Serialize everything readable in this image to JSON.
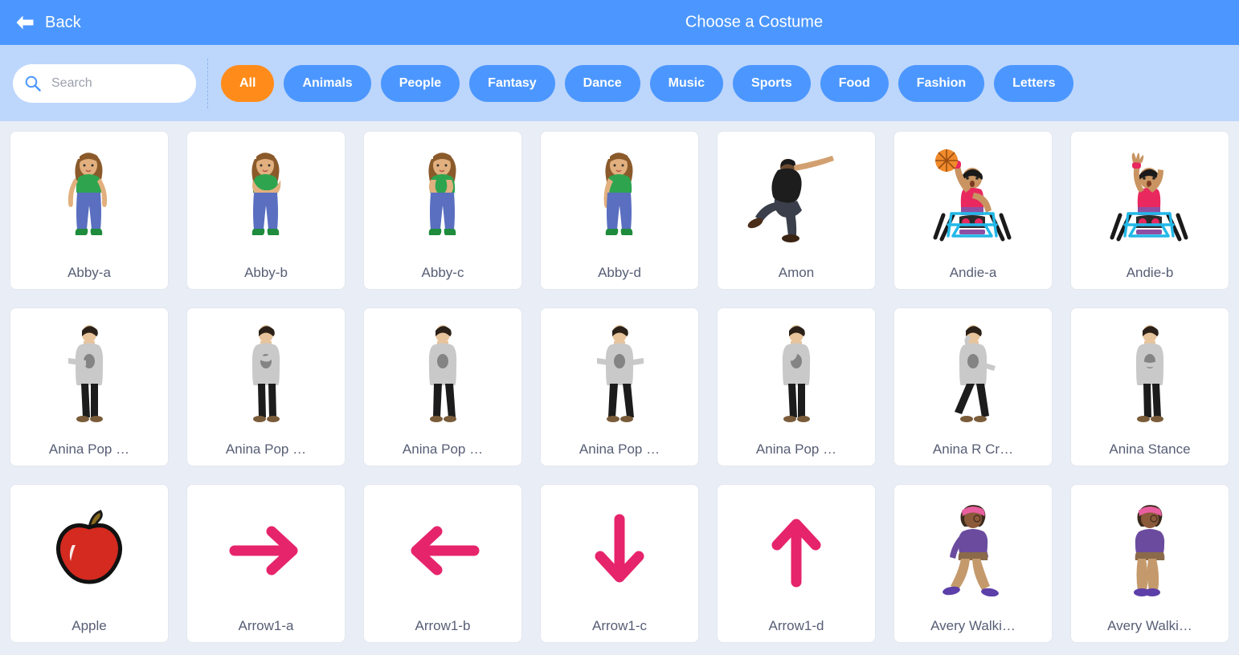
{
  "header": {
    "back_label": "Back",
    "back_icon": "left-arrow-icon",
    "title": "Choose a Costume",
    "bg_color": "#4C97FF"
  },
  "filterbar": {
    "bg_color": "#BDD6FC",
    "search": {
      "icon": "search-icon",
      "placeholder": "Search",
      "value": ""
    },
    "tags": [
      {
        "label": "All",
        "selected": true
      },
      {
        "label": "Animals",
        "selected": false
      },
      {
        "label": "People",
        "selected": false
      },
      {
        "label": "Fantasy",
        "selected": false
      },
      {
        "label": "Dance",
        "selected": false
      },
      {
        "label": "Music",
        "selected": false
      },
      {
        "label": "Sports",
        "selected": false
      },
      {
        "label": "Food",
        "selected": false
      },
      {
        "label": "Fashion",
        "selected": false
      },
      {
        "label": "Letters",
        "selected": false
      }
    ],
    "selected_color": "#FF8C1A",
    "tag_color": "#4C97FF"
  },
  "grid": {
    "bg_color": "#E9EEF6",
    "items": [
      {
        "label": "Abby-a",
        "thumb": "girl-green-shirt-standing"
      },
      {
        "label": "Abby-b",
        "thumb": "girl-green-shirt-arms-crossed"
      },
      {
        "label": "Abby-c",
        "thumb": "girl-green-shirt-hands-up"
      },
      {
        "label": "Abby-d",
        "thumb": "girl-green-shirt-side"
      },
      {
        "label": "Amon",
        "thumb": "man-black-shirt-leaning"
      },
      {
        "label": "Andie-a",
        "thumb": "wheelchair-basketball-throw"
      },
      {
        "label": "Andie-b",
        "thumb": "wheelchair-basketball-arms-up"
      },
      {
        "label": "Anina Pop …",
        "thumb": "woman-grey-sweater-arm-out"
      },
      {
        "label": "Anina Pop …",
        "thumb": "woman-grey-sweater-arm-front"
      },
      {
        "label": "Anina Pop …",
        "thumb": "woman-grey-sweater-standing"
      },
      {
        "label": "Anina Pop …",
        "thumb": "woman-grey-sweater-arms-out"
      },
      {
        "label": "Anina Pop …",
        "thumb": "woman-grey-sweater-arm-bent"
      },
      {
        "label": "Anina R Cr…",
        "thumb": "woman-grey-sweater-cross-step"
      },
      {
        "label": "Anina Stance",
        "thumb": "woman-grey-sweater-arms-folded"
      },
      {
        "label": "Apple",
        "thumb": "red-apple"
      },
      {
        "label": "Arrow1-a",
        "thumb": "arrow-right-pink"
      },
      {
        "label": "Arrow1-b",
        "thumb": "arrow-left-pink"
      },
      {
        "label": "Arrow1-c",
        "thumb": "arrow-down-pink"
      },
      {
        "label": "Arrow1-d",
        "thumb": "arrow-up-pink"
      },
      {
        "label": "Avery Walki…",
        "thumb": "girl-purple-shirt-walking"
      },
      {
        "label": "Avery Walki…",
        "thumb": "girl-purple-shirt-walking-side"
      }
    ]
  },
  "colors": {
    "arrow_pink": "#E6246B",
    "apple_red": "#D42A20",
    "shirt_green": "#2EA44F",
    "jeans_blue": "#5A6FC0",
    "skin": "#E2B07E",
    "hair_brown": "#8B5A2B",
    "label_text": "#575E75"
  }
}
